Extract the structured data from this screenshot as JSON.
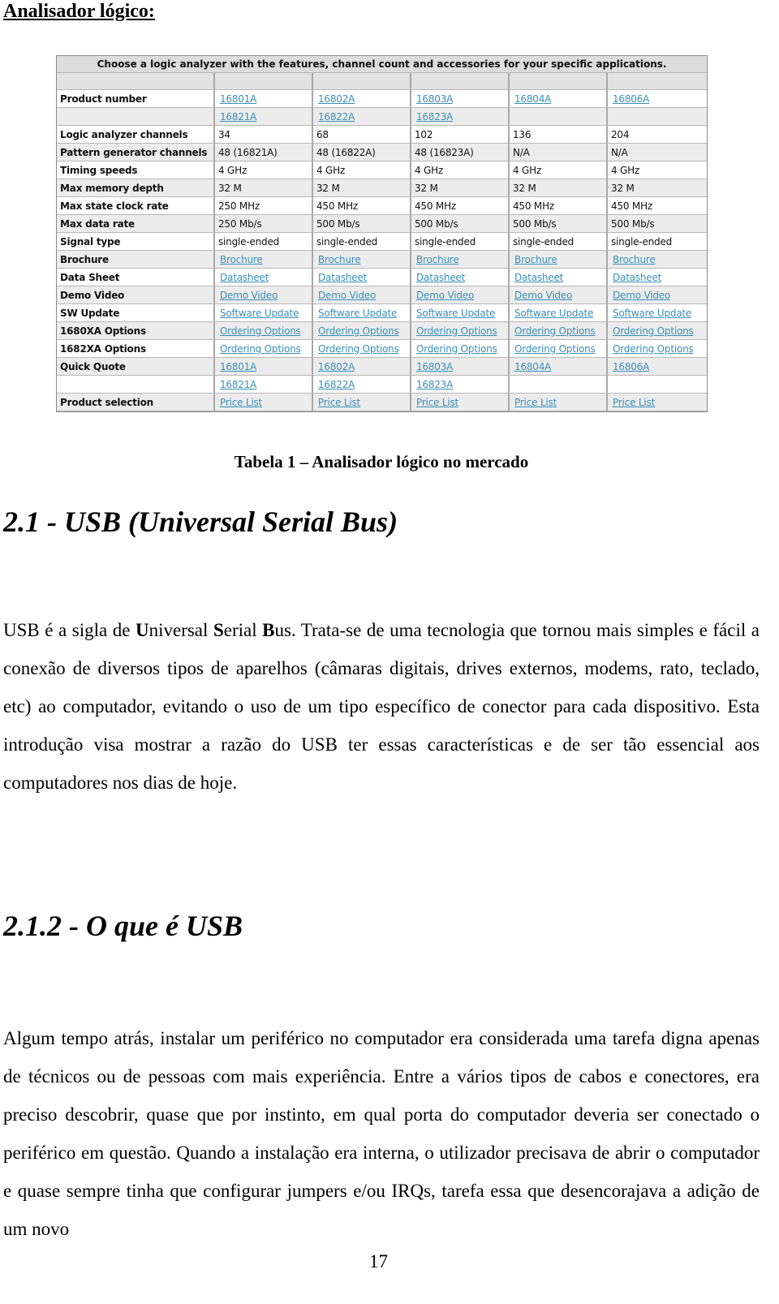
{
  "document": {
    "title": "Analisador lógico:",
    "table": {
      "caption_banner": "Choose a logic analyzer with the features, channel count and accessories for your specific applications.",
      "rows": [
        {
          "label": "Product number",
          "cells": [
            {
              "text": "16801A",
              "link": true
            },
            {
              "text": "16802A",
              "link": true
            },
            {
              "text": "16803A",
              "link": true
            },
            {
              "text": "16804A",
              "link": true
            },
            {
              "text": "16806A",
              "link": true
            }
          ]
        },
        {
          "label": "",
          "cells": [
            {
              "text": "16821A",
              "link": true
            },
            {
              "text": "16822A",
              "link": true
            },
            {
              "text": "16823A",
              "link": true
            },
            {
              "text": "",
              "link": false
            },
            {
              "text": "",
              "link": false
            }
          ]
        },
        {
          "label": "Logic analyzer channels",
          "cells": [
            {
              "text": "34",
              "link": false
            },
            {
              "text": "68",
              "link": false
            },
            {
              "text": "102",
              "link": false
            },
            {
              "text": "136",
              "link": false
            },
            {
              "text": "204",
              "link": false
            }
          ]
        },
        {
          "label": "Pattern generator channels",
          "cells": [
            {
              "text": "48 (16821A)",
              "link": false
            },
            {
              "text": "48 (16822A)",
              "link": false
            },
            {
              "text": "48 (16823A)",
              "link": false
            },
            {
              "text": "N/A",
              "link": false
            },
            {
              "text": "N/A",
              "link": false
            }
          ]
        },
        {
          "label": "Timing speeds",
          "cells": [
            {
              "text": "4 GHz",
              "link": false
            },
            {
              "text": "4 GHz",
              "link": false
            },
            {
              "text": "4 GHz",
              "link": false
            },
            {
              "text": "4 GHz",
              "link": false
            },
            {
              "text": "4 GHz",
              "link": false
            }
          ]
        },
        {
          "label": "Max memory depth",
          "cells": [
            {
              "text": "32 M",
              "link": false
            },
            {
              "text": "32 M",
              "link": false
            },
            {
              "text": "32 M",
              "link": false
            },
            {
              "text": "32 M",
              "link": false
            },
            {
              "text": "32 M",
              "link": false
            }
          ]
        },
        {
          "label": "Max state clock rate",
          "cells": [
            {
              "text": "250 MHz",
              "link": false
            },
            {
              "text": "450 MHz",
              "link": false
            },
            {
              "text": "450 MHz",
              "link": false
            },
            {
              "text": "450 MHz",
              "link": false
            },
            {
              "text": "450 MHz",
              "link": false
            }
          ]
        },
        {
          "label": "Max data rate",
          "cells": [
            {
              "text": "250 Mb/s",
              "link": false
            },
            {
              "text": "500 Mb/s",
              "link": false
            },
            {
              "text": "500 Mb/s",
              "link": false
            },
            {
              "text": "500 Mb/s",
              "link": false
            },
            {
              "text": "500 Mb/s",
              "link": false
            }
          ]
        },
        {
          "label": "Signal type",
          "cells": [
            {
              "text": "single-ended",
              "link": false
            },
            {
              "text": "single-ended",
              "link": false
            },
            {
              "text": "single-ended",
              "link": false
            },
            {
              "text": "single-ended",
              "link": false
            },
            {
              "text": "single-ended",
              "link": false
            }
          ]
        },
        {
          "label": "Brochure",
          "cells": [
            {
              "text": "Brochure",
              "link": true
            },
            {
              "text": "Brochure",
              "link": true
            },
            {
              "text": "Brochure",
              "link": true
            },
            {
              "text": "Brochure",
              "link": true
            },
            {
              "text": "Brochure",
              "link": true
            }
          ]
        },
        {
          "label": "Data Sheet",
          "cells": [
            {
              "text": "Datasheet",
              "link": true
            },
            {
              "text": "Datasheet",
              "link": true
            },
            {
              "text": "Datasheet",
              "link": true
            },
            {
              "text": "Datasheet",
              "link": true
            },
            {
              "text": "Datasheet",
              "link": true
            }
          ]
        },
        {
          "label": "Demo Video",
          "cells": [
            {
              "text": "Demo Video",
              "link": true
            },
            {
              "text": "Demo Video",
              "link": true
            },
            {
              "text": "Demo Video",
              "link": true
            },
            {
              "text": "Demo Video",
              "link": true
            },
            {
              "text": "Demo Video",
              "link": true
            }
          ]
        },
        {
          "label": "SW Update",
          "cells": [
            {
              "text": "Software Update",
              "link": true
            },
            {
              "text": "Software Update",
              "link": true
            },
            {
              "text": "Software Update",
              "link": true
            },
            {
              "text": "Software Update",
              "link": true
            },
            {
              "text": "Software Update",
              "link": true
            }
          ]
        },
        {
          "label": "1680XA Options",
          "cells": [
            {
              "text": "Ordering Options",
              "link": true
            },
            {
              "text": "Ordering Options",
              "link": true
            },
            {
              "text": "Ordering Options",
              "link": true
            },
            {
              "text": "Ordering Options",
              "link": true
            },
            {
              "text": "Ordering Options",
              "link": true
            }
          ]
        },
        {
          "label": "1682XA Options",
          "cells": [
            {
              "text": "Ordering Options",
              "link": true
            },
            {
              "text": "Ordering Options",
              "link": true
            },
            {
              "text": "Ordering Options",
              "link": true
            },
            {
              "text": "Ordering Options",
              "link": true
            },
            {
              "text": "Ordering Options",
              "link": true
            }
          ]
        },
        {
          "label": "Quick Quote",
          "cells": [
            {
              "text": "16801A",
              "link": true
            },
            {
              "text": "16802A",
              "link": true
            },
            {
              "text": "16803A",
              "link": true
            },
            {
              "text": "16804A",
              "link": true
            },
            {
              "text": "16806A",
              "link": true
            }
          ]
        },
        {
          "label": "",
          "cells": [
            {
              "text": "16821A",
              "link": true
            },
            {
              "text": "16822A",
              "link": true
            },
            {
              "text": "16823A",
              "link": true
            },
            {
              "text": "",
              "link": false
            },
            {
              "text": "",
              "link": false
            }
          ]
        },
        {
          "label": "Product selection",
          "cells": [
            {
              "text": "Price List",
              "link": true
            },
            {
              "text": "Price List",
              "link": true
            },
            {
              "text": "Price List",
              "link": true
            },
            {
              "text": "Price List",
              "link": true
            },
            {
              "text": "Price List",
              "link": true
            }
          ]
        }
      ],
      "link_color": "#3a8fb7"
    },
    "table_caption": "Tabela 1 – Analisador lógico no mercado",
    "section_usb": {
      "heading": "2.1 - USB (Universal Serial Bus)",
      "paragraph_parts": [
        {
          "text": "USB é a sigla de ",
          "bold": false
        },
        {
          "text": "U",
          "bold": true
        },
        {
          "text": "niversal ",
          "bold": false
        },
        {
          "text": "S",
          "bold": true
        },
        {
          "text": "erial ",
          "bold": false
        },
        {
          "text": "B",
          "bold": true
        },
        {
          "text": "us. Trata-se de uma tecnologia que tornou mais simples e fácil a conexão de diversos tipos de aparelhos (câmaras digitais, drives externos, modems, rato, teclado, etc) ao computador, evitando o uso de um tipo específico de conector para cada dispositivo. Esta introdução visa mostrar a razão do USB ter essas características e de ser tão essencial aos computadores nos dias de hoje.",
          "bold": false
        }
      ]
    },
    "section_oque": {
      "heading": "2.1.2 - O que é USB",
      "paragraph": "Algum tempo atrás, instalar um periférico no computador era considerada uma tarefa digna apenas de técnicos ou de pessoas com mais experiência. Entre a vários tipos de cabos e conectores, era preciso descobrir, quase que por instinto, em qual porta do computador deveria ser conectado o periférico em questão. Quando a instalação era interna, o utilizador precisava de abrir o computador e quase sempre tinha que configurar jumpers e/ou IRQs, tarefa essa que desencorajava a adição de um novo"
    },
    "page_number": "17"
  }
}
